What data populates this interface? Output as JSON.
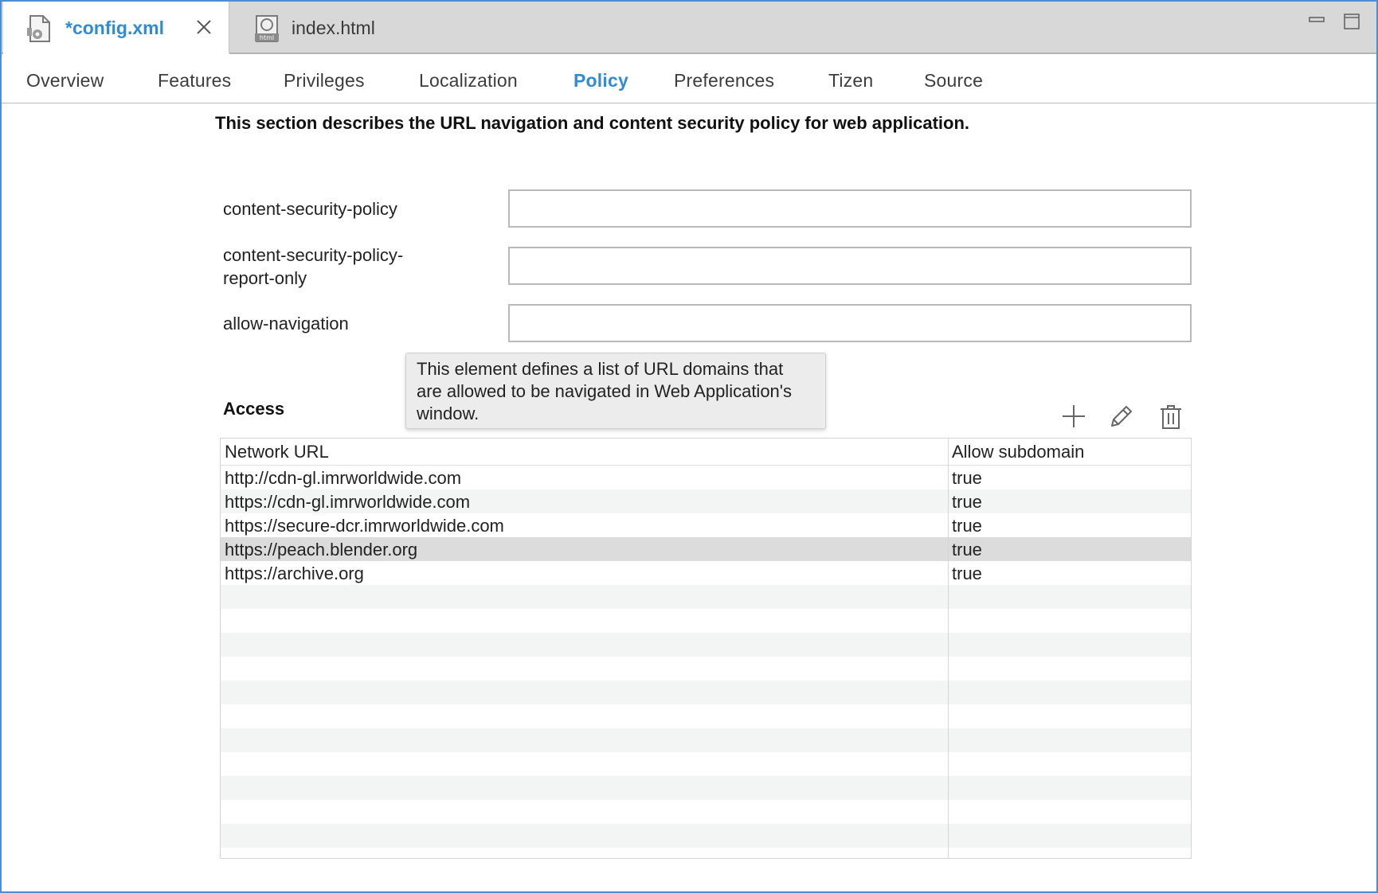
{
  "editor_tabs": [
    {
      "label": "*config.xml",
      "icon": "xml-file-icon",
      "active": true
    },
    {
      "label": "index.html",
      "icon": "html-file-icon",
      "active": false
    }
  ],
  "page_tabs": [
    "Overview",
    "Features",
    "Privileges",
    "Localization",
    "Policy",
    "Preferences",
    "Tizen",
    "Source"
  ],
  "active_page_tab": "Policy",
  "description": "This section describes the URL navigation and content security policy for web application.",
  "fields": [
    {
      "label_lines": [
        "content-security-policy"
      ],
      "value": ""
    },
    {
      "label_lines": [
        "content-security-policy-",
        "report-only"
      ],
      "value": ""
    },
    {
      "label_lines": [
        "allow-navigation"
      ],
      "value": ""
    }
  ],
  "tooltip": {
    "lines": [
      "This element defines a list of URL domains that",
      "are allowed to be navigated in Web Application's",
      "window."
    ]
  },
  "access": {
    "title": "Access",
    "toolbar": [
      "add-icon",
      "edit-pencil-icon",
      "trash-icon"
    ],
    "columns": [
      "Network URL",
      "Allow subdomain"
    ],
    "rows": [
      {
        "url": "http://cdn-gl.imrworldwide.com",
        "allow": "true"
      },
      {
        "url": "https://cdn-gl.imrworldwide.com",
        "allow": "true"
      },
      {
        "url": "https://secure-dcr.imrworldwide.com",
        "allow": "true"
      },
      {
        "url": "https://peach.blender.org",
        "allow": "true",
        "selected": true
      },
      {
        "url": "https://archive.org",
        "allow": "true"
      }
    ]
  },
  "colors": {
    "accent": "#2e8bd6",
    "window_border": "#4a8fd6",
    "row_alt": "#f3f4f4",
    "row_selected": "#dcdcdc"
  }
}
